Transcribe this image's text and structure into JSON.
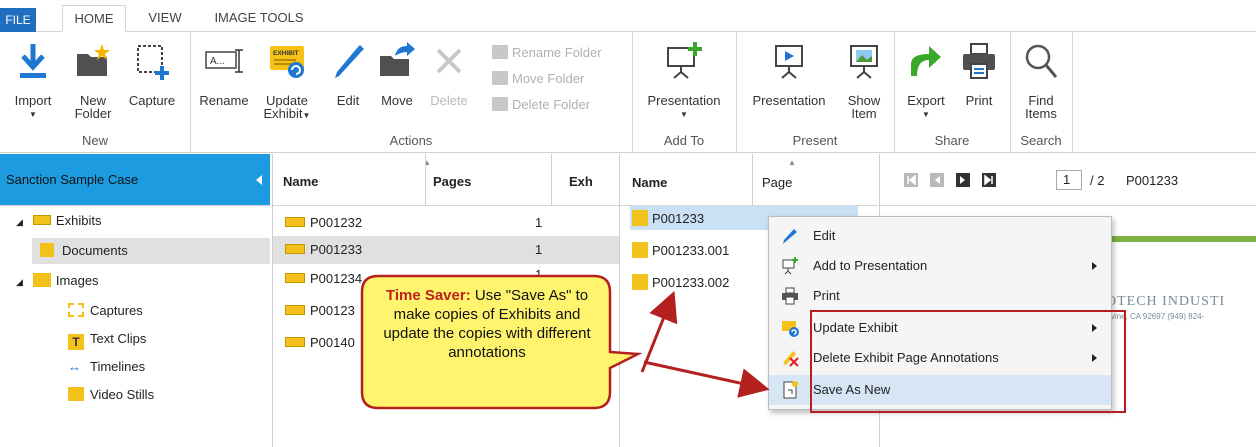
{
  "tabs": {
    "file": "FILE",
    "home": "HOME",
    "view": "VIEW",
    "image_tools": "IMAGE TOOLS"
  },
  "ribbon": {
    "import": "Import",
    "new_folder_1": "New",
    "new_folder_2": "Folder",
    "capture": "Capture",
    "group_new": "New",
    "rename": "Rename",
    "update_exhibit_1": "Update",
    "update_exhibit_2": "Exhibit",
    "edit": "Edit",
    "move": "Move",
    "delete": "Delete",
    "rename_folder": "Rename Folder",
    "move_folder": "Move Folder",
    "delete_folder": "Delete Folder",
    "group_actions": "Actions",
    "presentation_add": "Presentation",
    "group_add_to": "Add To",
    "presentation_present": "Presentation",
    "show_item_1": "Show",
    "show_item_2": "Item",
    "group_present": "Present",
    "export": "Export",
    "print": "Print",
    "group_share": "Share",
    "find_items_1": "Find",
    "find_items_2": "Items",
    "group_search": "Search",
    "exhibit_icon_text": "EXHIBIT",
    "rename_icon_text": "A..."
  },
  "case": {
    "title": "Sanction Sample Case",
    "tree": [
      "Exhibits",
      "Documents",
      "Images",
      "Captures",
      "Text Clips",
      "Timelines",
      "Video Stills"
    ]
  },
  "exhibits_list": {
    "col_name": "Name",
    "col_pages": "Pages",
    "col_exh": "Exh",
    "rows": [
      {
        "name": "P001232",
        "pages": "1"
      },
      {
        "name": "P001233",
        "pages": "1"
      },
      {
        "name": "P001234",
        "pages": "1"
      },
      {
        "name": "P00123",
        "pages": ""
      },
      {
        "name": "P00140",
        "pages": ""
      }
    ]
  },
  "pages_list": {
    "col_name": "Name",
    "col_page": "Page",
    "rows": [
      "P001233",
      "P001233.001",
      "P001233.002"
    ]
  },
  "viewer": {
    "page_num": "1",
    "page_total": "/ 2",
    "doc_name": "P001233",
    "preview_text_1": "OTECH INDUSTI",
    "preview_text_2": "Irvine, CA 92697 (949) 824-"
  },
  "menu": {
    "items": [
      "Edit",
      "Add to Presentation",
      "Print",
      "Update Exhibit",
      "Delete Exhibit Page Annotations",
      "Save As New"
    ]
  },
  "callout": {
    "bold": "Time Saver:",
    "text": " Use \"Save As\" to make copies of Exhibits and update the copies with different annotations"
  },
  "colors": {
    "accent_blue": "#1d9be0",
    "callout_yellow": "#fff27a",
    "callout_border": "#b3201e",
    "highlight": "#d6e6f5"
  }
}
